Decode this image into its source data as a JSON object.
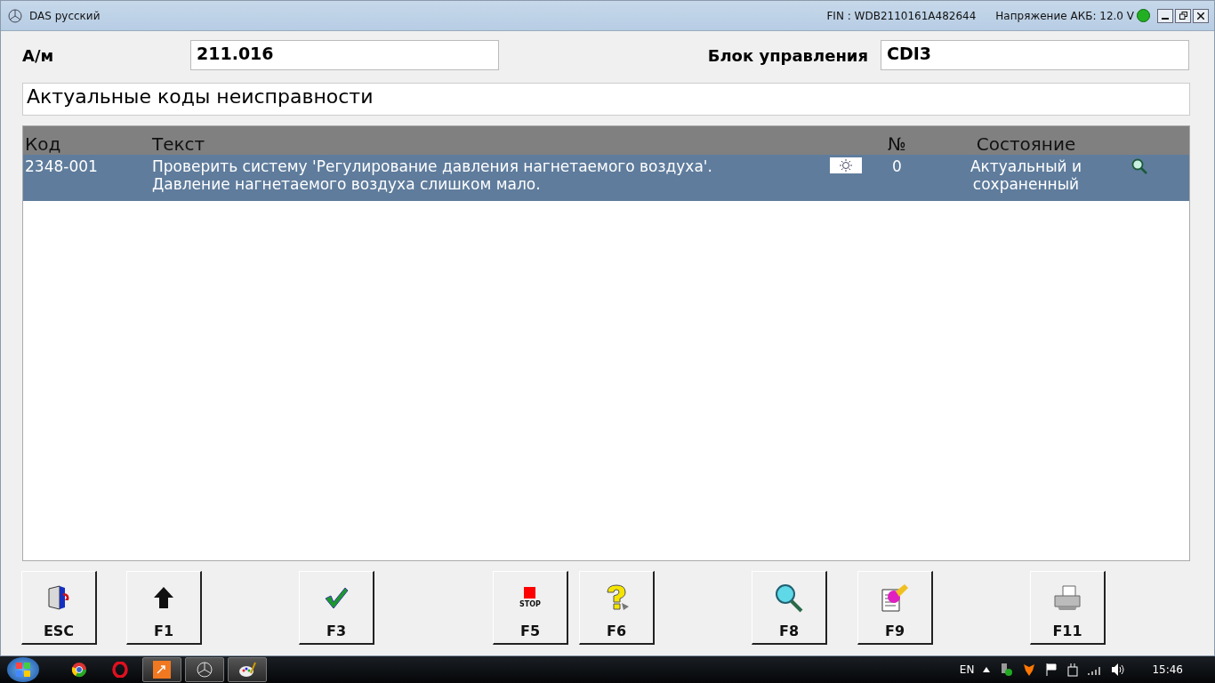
{
  "window": {
    "title": "DAS русский",
    "fin": "FIN : WDB2110161A482644",
    "battery": "Напряжение АКБ: 12.0 V",
    "battery_ok": true
  },
  "header": {
    "vehicle_label": "А/м",
    "vehicle_value": "211.016",
    "unit_label": "Блок управления",
    "unit_value": "CDI3"
  },
  "section_title": "Актуальные коды неисправности",
  "table": {
    "columns": [
      "Код",
      "Текст",
      "№",
      "Состояние"
    ],
    "rows": [
      {
        "code": "2348-001",
        "text": "Проверить систему 'Регулирование давления нагнетаемого воздуха'. Давление нагнетаемого воздуха слишком мало.",
        "number": "0",
        "status": "Актуальный и сохраненный",
        "selected": true
      }
    ]
  },
  "buttons": [
    {
      "key": "ESC",
      "kind": "exit"
    },
    {
      "key": "F1",
      "kind": "up"
    },
    {
      "key": "F3",
      "kind": "check"
    },
    {
      "key": "F5",
      "kind": "stop",
      "icon_text": "STOP"
    },
    {
      "key": "F6",
      "kind": "help"
    },
    {
      "key": "F8",
      "kind": "search"
    },
    {
      "key": "F9",
      "kind": "edit"
    },
    {
      "key": "F11",
      "kind": "print"
    }
  ],
  "taskbar": {
    "apps": [
      {
        "kind": "chrome",
        "active": false
      },
      {
        "kind": "opera",
        "active": false
      },
      {
        "kind": "orange",
        "active": true
      },
      {
        "kind": "star",
        "active": true
      },
      {
        "kind": "paint",
        "active": true
      }
    ],
    "language": "EN",
    "time": "15:46"
  }
}
